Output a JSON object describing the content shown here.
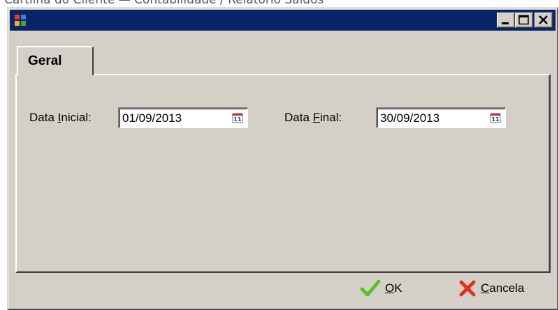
{
  "background_caption": "Cartilha do Cliente — Contabilidade / Relatório Saldos",
  "window": {
    "title": "",
    "controls": {
      "minimize": "minimize",
      "maximize": "maximize",
      "close": "close"
    }
  },
  "tabs": [
    {
      "label": "Geral",
      "active": true
    }
  ],
  "form": {
    "data_inicial": {
      "label_before": "Data ",
      "label_mnemonic": "I",
      "label_after": "nicial:",
      "value": "01/09/2013"
    },
    "data_final": {
      "label_before": "Data ",
      "label_mnemonic": "F",
      "label_after": "inal:",
      "value": "30/09/2013"
    }
  },
  "footer": {
    "ok": {
      "mnemonic": "O",
      "rest": "K",
      "icon": "checkmark-icon"
    },
    "cancel": {
      "mnemonic": "C",
      "rest": "ancela",
      "icon": "x-icon"
    }
  },
  "colors": {
    "titlebar": "#0a246a",
    "face": "#d4d0c8",
    "ok_green": "#5cc02a",
    "cancel_red": "#e0321e"
  }
}
